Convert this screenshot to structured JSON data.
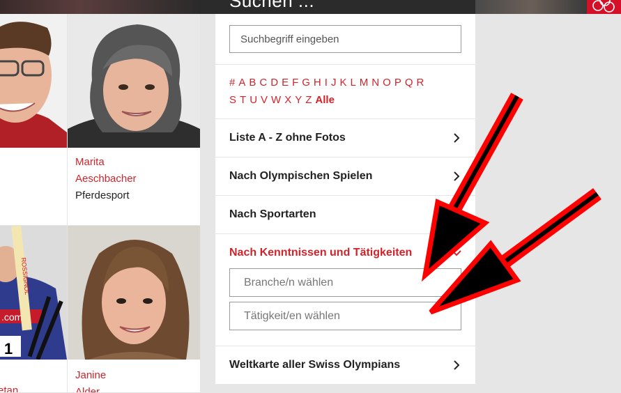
{
  "header": {
    "search_title": "Suchen ...",
    "olympic_logo_icon": "olympic-rings-icon"
  },
  "athletes": [
    {
      "first": "",
      "last": "",
      "sport": ""
    },
    {
      "first": "Marita",
      "last": "Aeschbacher",
      "sport": "Pferdesport"
    },
    {
      "first": "",
      "last": "etan",
      "sport": ""
    },
    {
      "first": "Janine",
      "last": "Alder",
      "sport": ""
    }
  ],
  "panel": {
    "search_placeholder": "Suchbegriff eingeben",
    "alphabet": [
      "#",
      "A",
      "B",
      "C",
      "D",
      "E",
      "F",
      "G",
      "H",
      "I",
      "J",
      "K",
      "L",
      "M",
      "N",
      "O",
      "P",
      "Q",
      "R",
      "S",
      "T",
      "U",
      "V",
      "W",
      "X",
      "Y",
      "Z"
    ],
    "alphabet_all": "Alle",
    "menu": [
      {
        "label": "Liste A - Z ohne Fotos",
        "chevron": "chevron-right-icon"
      },
      {
        "label": "Nach Olympischen Spielen",
        "chevron": "chevron-right-icon"
      },
      {
        "label": "Nach Sportarten",
        "chevron": ""
      },
      {
        "label": "Nach Kenntnissen und Tätigkeiten",
        "chevron": "chevron-down-icon"
      }
    ],
    "select_branche": "Branche/n wählen",
    "select_taetigkeit": "Tätigkeit/en wählen",
    "world_map": "Weltkarte aller Swiss Olympians"
  },
  "colors": {
    "accent": "#d2232a",
    "arrow": "#ff0000"
  }
}
